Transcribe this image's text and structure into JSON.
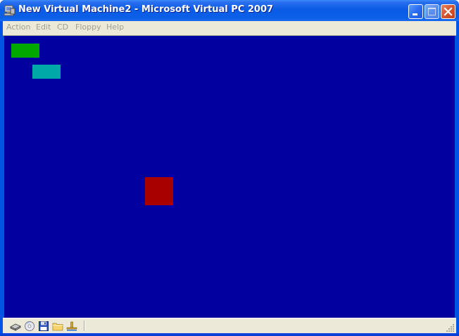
{
  "window": {
    "title": "New Virtual Machine2 - Microsoft Virtual PC 2007",
    "app_icon": "virtual-pc-icon",
    "controls": {
      "minimize": "minimize-icon",
      "maximize": "maximize-icon",
      "close": "close-icon"
    }
  },
  "menubar": {
    "items": [
      {
        "label": "Action"
      },
      {
        "label": "Edit"
      },
      {
        "label": "CD"
      },
      {
        "label": "Floppy"
      },
      {
        "label": "Help"
      }
    ],
    "disabled_color": "#a19f94"
  },
  "screen": {
    "background": "#0300a0",
    "blocks": [
      {
        "color": "#00a800",
        "name": "green"
      },
      {
        "color": "#00a8a8",
        "name": "cyan"
      },
      {
        "color": "#a80000",
        "name": "red"
      }
    ]
  },
  "statusbar": {
    "icons": [
      "hard-disk-icon",
      "cd-drive-icon",
      "floppy-disk-icon",
      "shared-folder-icon",
      "network-icon"
    ]
  }
}
